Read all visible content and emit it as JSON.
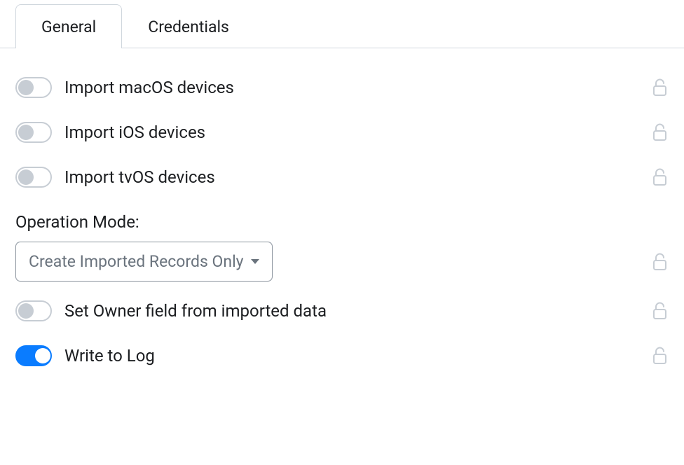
{
  "tabs": {
    "general": "General",
    "credentials": "Credentials"
  },
  "settings": {
    "import_macos": {
      "label": "Import macOS devices",
      "on": false
    },
    "import_ios": {
      "label": "Import iOS devices",
      "on": false
    },
    "import_tvos": {
      "label": "Import tvOS devices",
      "on": false
    },
    "set_owner": {
      "label": "Set Owner field from imported data",
      "on": false
    },
    "write_log": {
      "label": "Write to Log",
      "on": true
    }
  },
  "operation_mode": {
    "label": "Operation Mode:",
    "selected": "Create Imported Records Only"
  }
}
